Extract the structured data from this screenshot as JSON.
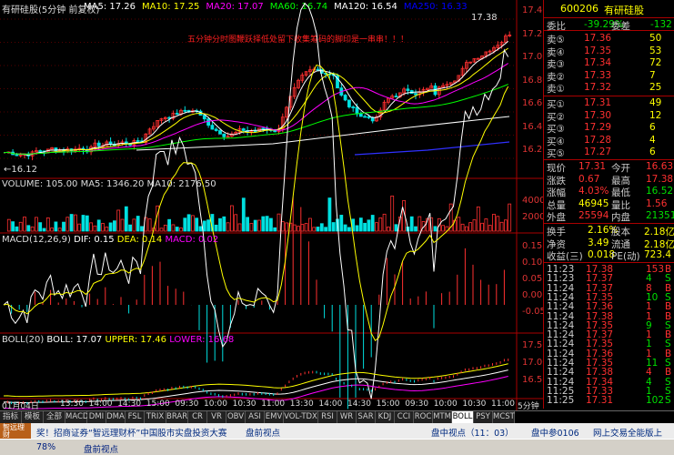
{
  "header": {
    "title": "有研硅股(5分钟 前复权)",
    "ma": [
      {
        "label": "MA5: 17.26",
        "color": "#ffffff"
      },
      {
        "label": "MA10: 17.25",
        "color": "#ffff00"
      },
      {
        "label": "MA20: 17.07",
        "color": "#ff00ff"
      },
      {
        "label": "MA60: 16.74",
        "color": "#00ff00"
      },
      {
        "label": "MA120: 16.54",
        "color": "#ffffff"
      },
      {
        "label": "MA250: 16.33",
        "color": "#0000ff"
      }
    ]
  },
  "annotation": "五分钟分时图鞭跃择低处留下收集筹码的脚印是一串串！！！",
  "price_panel": {
    "high_label": "17.38",
    "low_label": "16.12",
    "axis": [
      "17.40",
      "17.20",
      "17.00",
      "16.80",
      "16.60",
      "16.40",
      "16.20"
    ]
  },
  "volume_panel": {
    "header": "VOLUME: 105.00  MA5: 1346.20  MA10: 2176.50",
    "axis": [
      "4000",
      "2000"
    ]
  },
  "macd_panel": {
    "header_prefix": "MACD(12,26,9)",
    "dif": "DIF: 0.15",
    "dea": "DEA: 0.14",
    "macd": "MACD: 0.02",
    "axis": [
      "0.15",
      "0.10",
      "0.05",
      "0.00",
      "-0.05"
    ]
  },
  "boll_panel": {
    "header_prefix": "BOLL(20)",
    "boll": "BOLL: 17.07",
    "upper": "UPPER: 17.46",
    "lower": "LOWER: 16.68",
    "axis": [
      "17.50",
      "17.00",
      "16.50"
    ]
  },
  "time_axis": {
    "date": "01月04日",
    "times": [
      "13:30",
      "14:00",
      "14:30",
      "15:00",
      "09:30",
      "10:00",
      "10:30",
      "11:00",
      "13:30",
      "14:00",
      "14:30",
      "15:00",
      "09:30",
      "10:00",
      "10:30",
      "11:00"
    ],
    "period": "5分钟"
  },
  "quote": {
    "code": "600206",
    "name": "有研硅股",
    "webi_label": "委比",
    "webi_value": "-39.29%",
    "weicha_label": "委差",
    "weicha_value": "-132",
    "sell": [
      {
        "label": "卖⑤",
        "price": "17.36",
        "vol": "50"
      },
      {
        "label": "卖④",
        "price": "17.35",
        "vol": "53"
      },
      {
        "label": "卖③",
        "price": "17.34",
        "vol": "72"
      },
      {
        "label": "卖②",
        "price": "17.33",
        "vol": "7"
      },
      {
        "label": "卖①",
        "price": "17.32",
        "vol": "25"
      }
    ],
    "buy": [
      {
        "label": "买①",
        "price": "17.31",
        "vol": "49"
      },
      {
        "label": "买②",
        "price": "17.30",
        "vol": "12"
      },
      {
        "label": "买③",
        "price": "17.29",
        "vol": "6"
      },
      {
        "label": "买④",
        "price": "17.28",
        "vol": "4"
      },
      {
        "label": "买⑤",
        "price": "17.27",
        "vol": "6"
      }
    ],
    "stats": [
      {
        "l1": "现价",
        "v1": "17.31",
        "l2": "今开",
        "v2": "16.63",
        "c1": "#ff3030",
        "c2": "#ff3030"
      },
      {
        "l1": "涨跌",
        "v1": "0.67",
        "l2": "最高",
        "v2": "17.38",
        "c1": "#ff3030",
        "c2": "#ff3030"
      },
      {
        "l1": "涨幅",
        "v1": "4.03%",
        "l2": "最低",
        "v2": "16.52",
        "c1": "#ff3030",
        "c2": "#00e000"
      },
      {
        "l1": "总量",
        "v1": "46945",
        "l2": "量比",
        "v2": "1.56",
        "c1": "#ffff00",
        "c2": "#ff3030"
      },
      {
        "l1": "外盘",
        "v1": "25594",
        "l2": "内盘",
        "v2": "21351",
        "c1": "#ff3030",
        "c2": "#00e000"
      }
    ],
    "stats2": [
      {
        "l1": "换手",
        "v1": "2.16%",
        "l2": "股本",
        "v2": "2.18亿"
      },
      {
        "l1": "净资",
        "v1": "3.49",
        "l2": "流通",
        "v2": "2.18亿"
      },
      {
        "l1": "收益(三)",
        "v1": "0.018",
        "l2": "PE(动)",
        "v2": "723.4"
      }
    ],
    "ticks": [
      {
        "t": "11:23",
        "p": "17.38",
        "v": "153",
        "s": "B"
      },
      {
        "t": "11:23",
        "p": "17.37",
        "v": "4",
        "s": "S"
      },
      {
        "t": "11:24",
        "p": "17.37",
        "v": "8",
        "s": "B"
      },
      {
        "t": "11:24",
        "p": "17.35",
        "v": "10",
        "s": "S"
      },
      {
        "t": "11:24",
        "p": "17.36",
        "v": "1",
        "s": "B"
      },
      {
        "t": "11:24",
        "p": "17.38",
        "v": "1",
        "s": "B"
      },
      {
        "t": "11:24",
        "p": "17.35",
        "v": "9",
        "s": "S"
      },
      {
        "t": "11:24",
        "p": "17.37",
        "v": "1",
        "s": "B"
      },
      {
        "t": "11:24",
        "p": "17.35",
        "v": "1",
        "s": "S"
      },
      {
        "t": "11:24",
        "p": "17.36",
        "v": "1",
        "s": "B"
      },
      {
        "t": "11:24",
        "p": "17.35",
        "v": "11",
        "s": "S"
      },
      {
        "t": "11:24",
        "p": "17.38",
        "v": "4",
        "s": "B"
      },
      {
        "t": "11:24",
        "p": "17.34",
        "v": "4",
        "s": "S"
      },
      {
        "t": "11:25",
        "p": "17.33",
        "v": "1",
        "s": "S"
      },
      {
        "t": "11:25",
        "p": "17.31",
        "v": "102",
        "s": "S"
      }
    ]
  },
  "tabs": [
    "指标",
    "模板",
    "全部",
    "MACD",
    "DMI",
    "DMA",
    "FSL",
    "TRIX",
    "BRAR",
    "CR",
    "VR",
    "OBV",
    "ASI",
    "EMV",
    "VOL-TDX",
    "RSI",
    "WR",
    "SAR",
    "KDJ",
    "CCI",
    "ROC",
    "MTM",
    "BOLL",
    "PSY",
    "MCST"
  ],
  "active_tab": "BOLL",
  "ticker": {
    "logo": "智远理财",
    "text": "奖！招商证券“智远理财杯”中国股市实盘投资大赛",
    "item2": "盘前视点",
    "item3": "盘中视点（11：03）",
    "item4": "盘中参0106",
    "item5": "网上交易全能版上"
  },
  "status": {
    "zoom": "78%",
    "text": "盘前视点"
  }
}
